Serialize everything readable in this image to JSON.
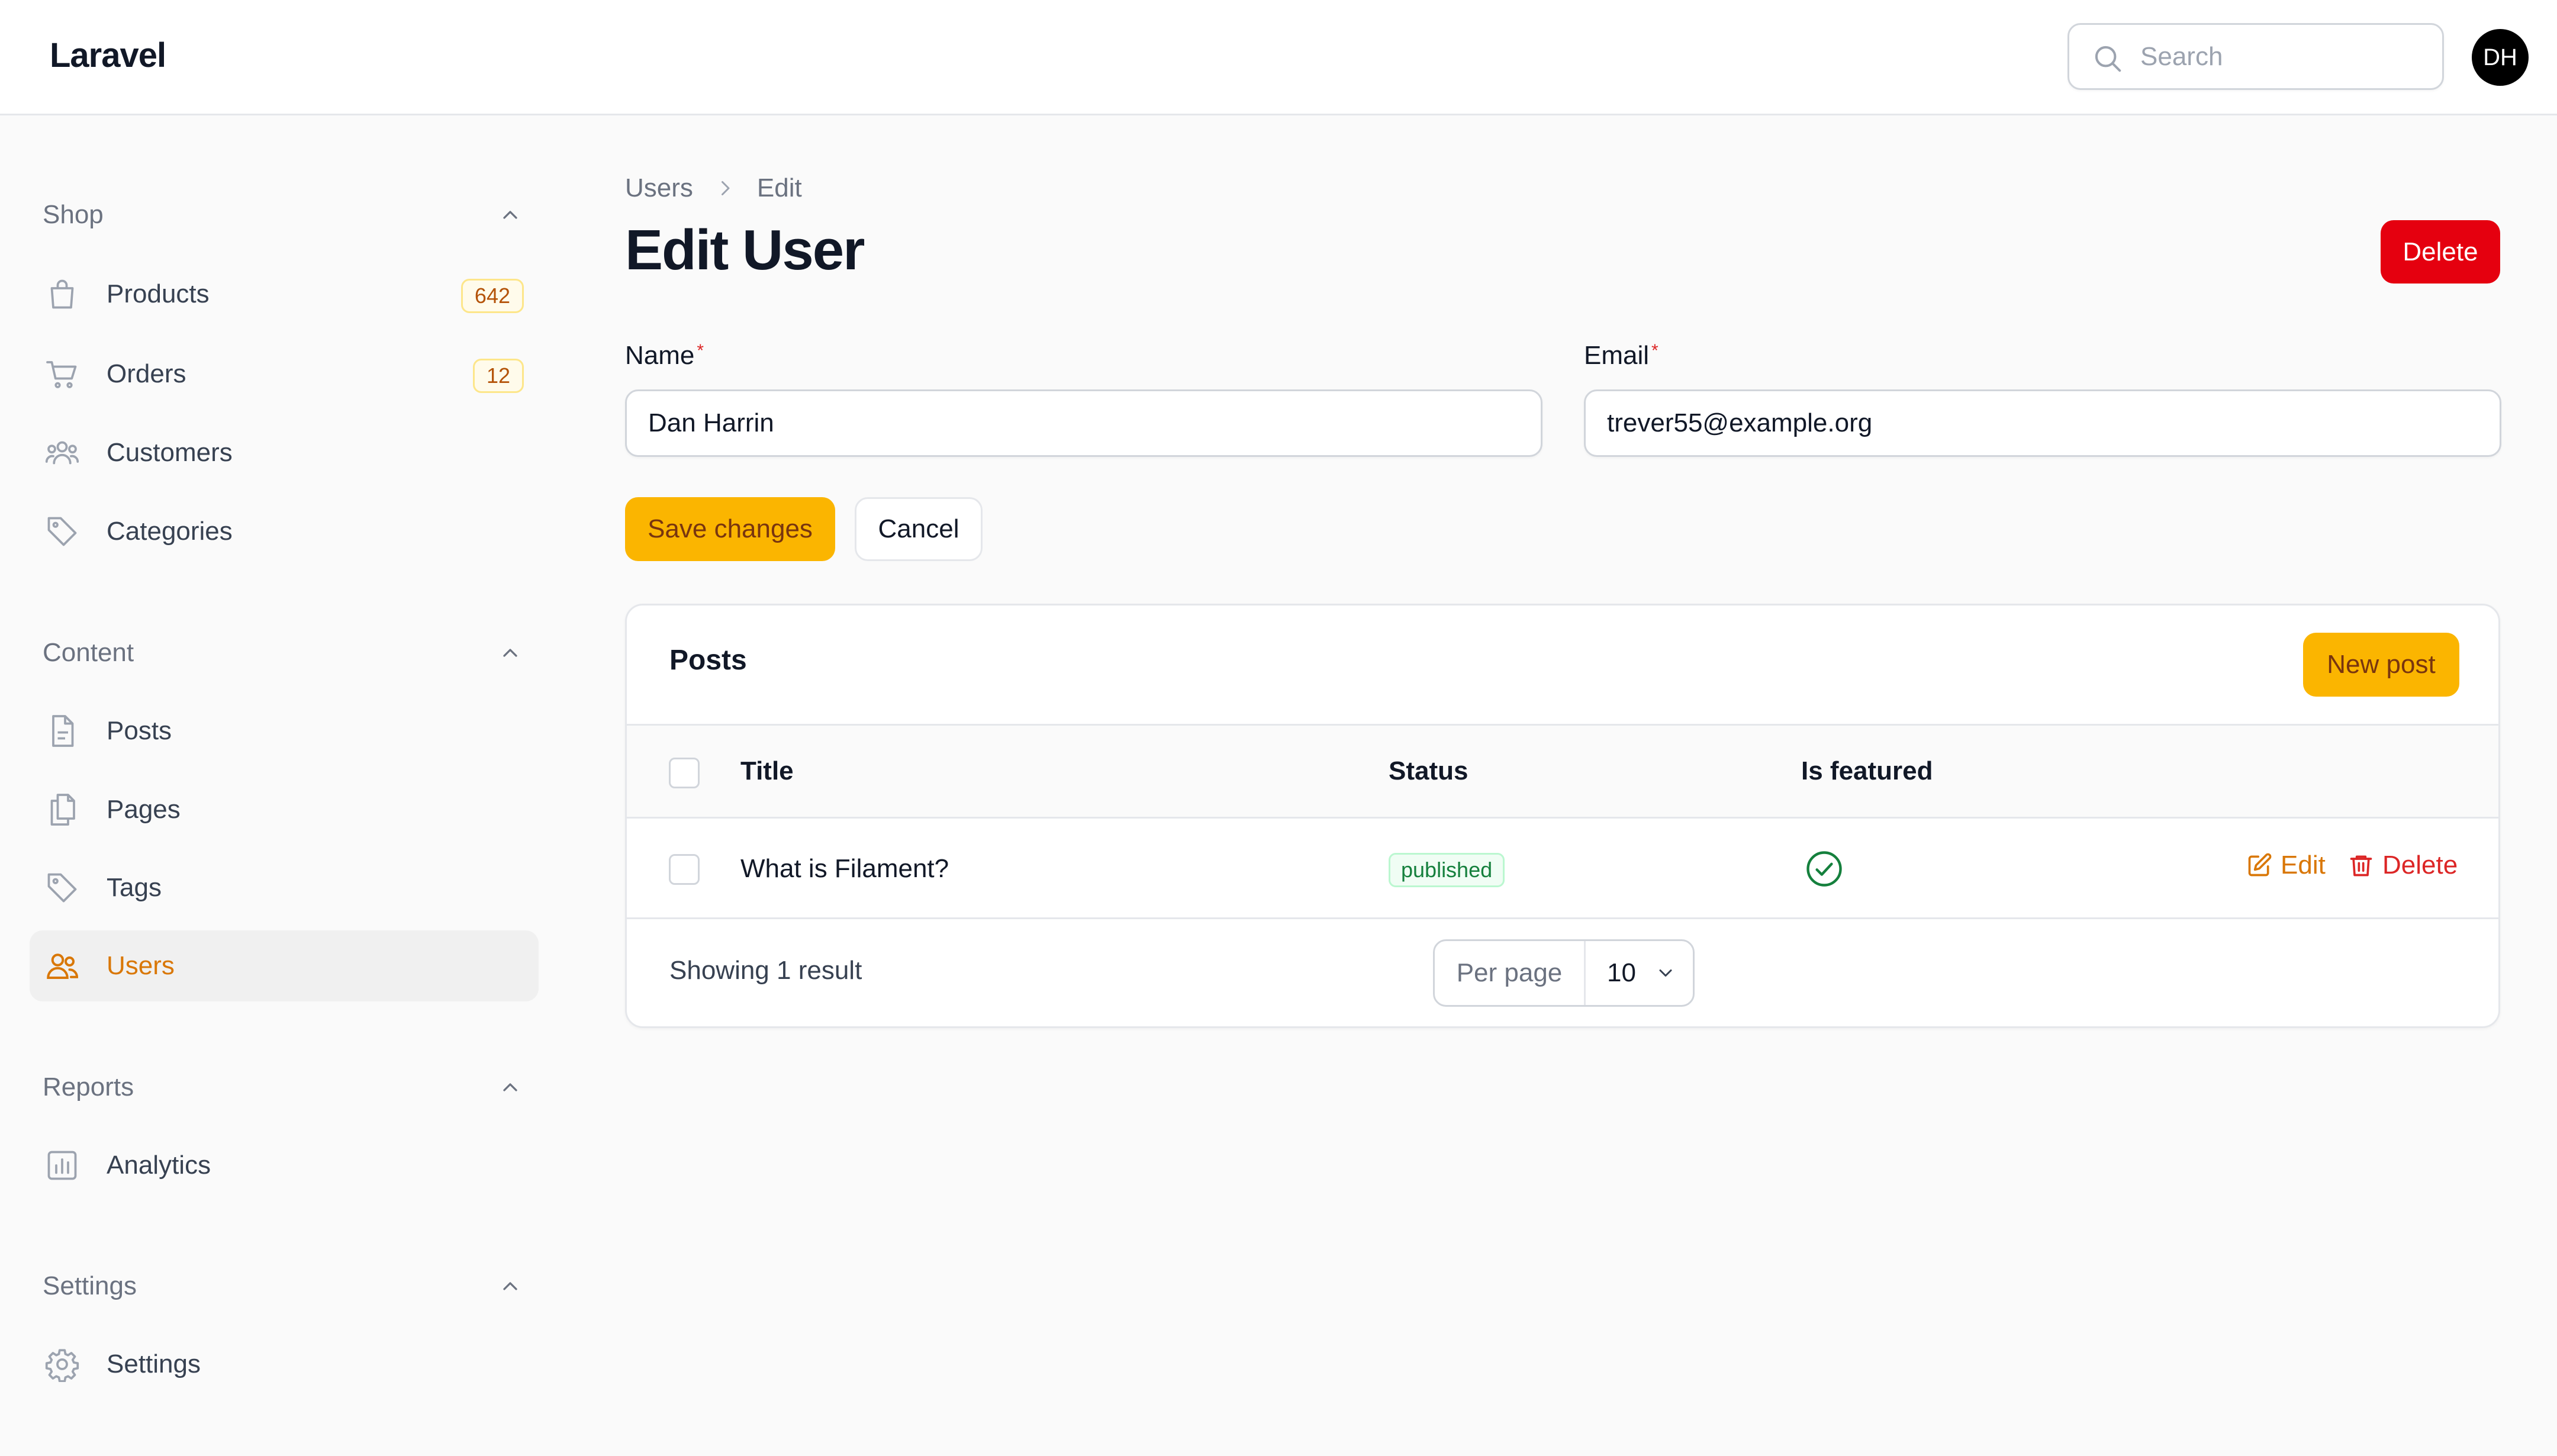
{
  "header": {
    "brand": "Laravel",
    "search_placeholder": "Search",
    "avatar_initials": "DH"
  },
  "sidebar": {
    "groups": [
      {
        "label": "Shop",
        "items": [
          {
            "label": "Products",
            "icon": "shopping-bag-icon",
            "badge": "642"
          },
          {
            "label": "Orders",
            "icon": "shopping-cart-icon",
            "badge": "12"
          },
          {
            "label": "Customers",
            "icon": "users-group-icon"
          },
          {
            "label": "Categories",
            "icon": "tag-icon"
          }
        ]
      },
      {
        "label": "Content",
        "items": [
          {
            "label": "Posts",
            "icon": "document-icon"
          },
          {
            "label": "Pages",
            "icon": "documents-icon"
          },
          {
            "label": "Tags",
            "icon": "tag-icon"
          },
          {
            "label": "Users",
            "icon": "users-icon",
            "active": true
          }
        ]
      },
      {
        "label": "Reports",
        "items": [
          {
            "label": "Analytics",
            "icon": "chart-bar-icon"
          }
        ]
      },
      {
        "label": "Settings",
        "items": [
          {
            "label": "Settings",
            "icon": "cog-icon"
          }
        ]
      }
    ]
  },
  "breadcrumb": [
    "Users",
    "Edit"
  ],
  "page": {
    "title": "Edit User",
    "delete_label": "Delete"
  },
  "form": {
    "name": {
      "label": "Name",
      "required_mark": "*",
      "value": "Dan Harrin"
    },
    "email": {
      "label": "Email",
      "required_mark": "*",
      "value": "trever55@example.org"
    },
    "save_label": "Save changes",
    "cancel_label": "Cancel"
  },
  "posts": {
    "title": "Posts",
    "new_label": "New post",
    "columns": {
      "title": "Title",
      "status": "Status",
      "featured": "Is featured"
    },
    "rows": [
      {
        "title": "What is Filament?",
        "status": "published",
        "featured": true,
        "edit_label": "Edit",
        "delete_label": "Delete"
      }
    ],
    "footer": {
      "result_text": "Showing 1 result",
      "per_page_label": "Per page",
      "per_page_value": "10"
    }
  },
  "colors": {
    "primary": "#fbb500",
    "danger": "#e5000f",
    "active_text": "#d97706",
    "success": "#15803d"
  }
}
